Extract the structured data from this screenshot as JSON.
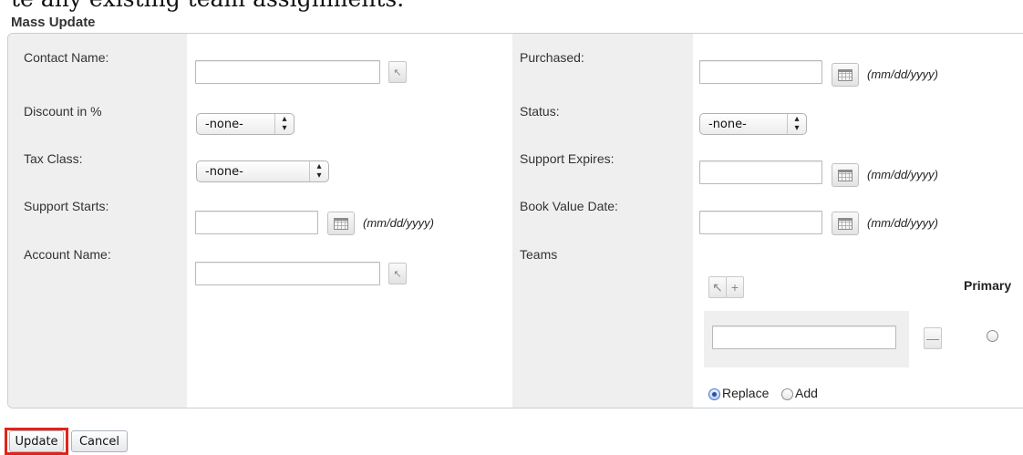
{
  "header": {
    "clipped_text": "te any existing team assignments.",
    "title": "Mass Update"
  },
  "fields": {
    "contact_name": {
      "label": "Contact Name:",
      "value": ""
    },
    "discount": {
      "label": "Discount in %",
      "selected": "-none-"
    },
    "tax_class": {
      "label": "Tax Class:",
      "selected": "-none-"
    },
    "support_starts": {
      "label": "Support Starts:",
      "value": "",
      "hint": "(mm/dd/yyyy)"
    },
    "account_name": {
      "label": "Account Name:",
      "value": ""
    },
    "purchased": {
      "label": "Purchased:",
      "value": "",
      "hint": "(mm/dd/yyyy)"
    },
    "status": {
      "label": "Status:",
      "selected": "-none-"
    },
    "support_expires": {
      "label": "Support Expires:",
      "value": "",
      "hint": "(mm/dd/yyyy)"
    },
    "book_value_date": {
      "label": "Book Value Date:",
      "value": "",
      "hint": "(mm/dd/yyyy)"
    },
    "teams": {
      "label": "Teams",
      "primary_header": "Primary",
      "team_value": "",
      "mode_options": [
        "Replace",
        "Add"
      ],
      "mode_selected": "Replace"
    }
  },
  "actions": {
    "update_label": "Update",
    "cancel_label": "Cancel"
  },
  "icons": {
    "select_arrow": "cursor-arrow-icon",
    "calendar": "calendar-icon",
    "add": "plus-icon",
    "remove": "minus-icon",
    "dropdown": "updown-arrows-icon"
  },
  "colors": {
    "label_column": "#efefef",
    "panel_border": "#c8ced6",
    "highlight": "#e02418"
  }
}
